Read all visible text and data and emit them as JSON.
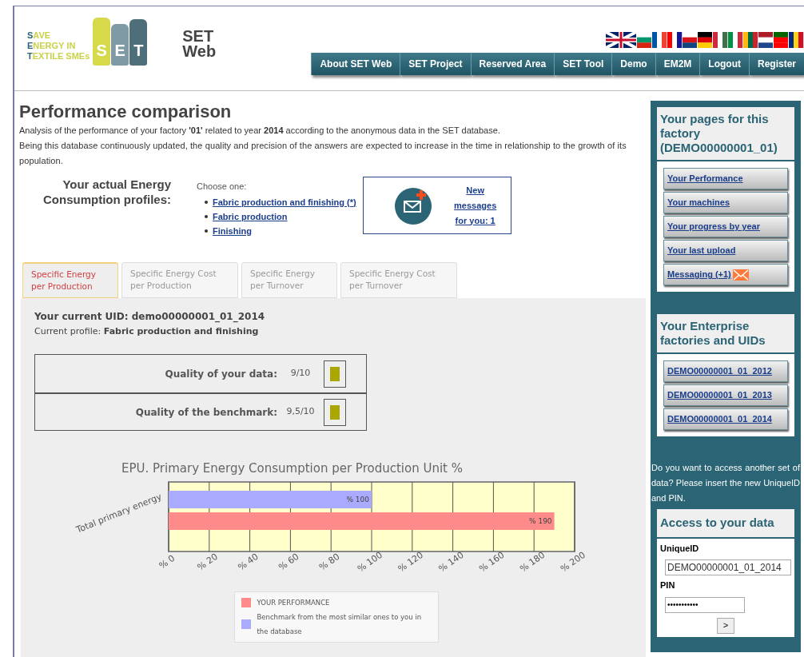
{
  "logo": {
    "lines": [
      "SAVE",
      "ENERGY IN",
      "TEXTILE SMEs"
    ],
    "spool_letters": [
      "S",
      "E",
      "T"
    ]
  },
  "site_title": [
    "SET",
    "Web"
  ],
  "nav": [
    "About SET Web",
    "SET Project",
    "Reserved Area",
    "SET Tool",
    "Demo",
    "EM2M",
    "Logout",
    "Register"
  ],
  "page": {
    "title": "Performance comparison",
    "intro": "Analysis of the performance of your factory **'01'** related to year **2014** according to the anonymous data in the SET database.",
    "note": "Being this database continuously updated, the quality and precision of the answers are expected to increase in the time in relationship to the growth of its population.",
    "profiles_label": "Your actual Energy Consumption profiles:",
    "choose": "Choose one:",
    "profiles": [
      "Fabric production and finishing (*)",
      "Fabric production",
      "Finishing"
    ],
    "messages_link": "New messages for you: 1"
  },
  "tabs": [
    {
      "label": "Specific Energy per Production",
      "selected": true
    },
    {
      "label": "Specific Energy Cost per Production",
      "selected": false
    },
    {
      "label": "Specific Energy per Turnover",
      "selected": false
    },
    {
      "label": "Specific Energy Cost per Turnover",
      "selected": false
    }
  ],
  "panel": {
    "uid": "Your current UID: demo00000001_01_2014",
    "profile_label": "Current profile:",
    "profile": "Fabric production and finishing",
    "quality": [
      {
        "label": "Quality of your data:",
        "value": "9/10",
        "color": "#aaa800"
      },
      {
        "label": "Quality of the benchmark:",
        "value": "9,5/10",
        "color": "#aaa800"
      }
    ],
    "chart_data": {
      "type": "bar",
      "orientation": "horizontal",
      "title": "EPU. Primary Energy Consumption per Production Unit %",
      "categories": [
        "Total primary energy"
      ],
      "series": [
        {
          "name": "Benchmark from the most similar ones to you in the database",
          "color": "#aaaaff",
          "values": [
            100
          ],
          "value_labels": [
            "% 100"
          ]
        },
        {
          "name": "YOUR PERFORMANCE",
          "color": "#ff8a8a",
          "values": [
            190
          ],
          "value_labels": [
            "% 190"
          ]
        }
      ],
      "legend": "bottom",
      "xlim": [
        0,
        200
      ],
      "xticks": [
        {
          "value": 0,
          "label": "% 0"
        },
        {
          "value": 20,
          "label": "% 20"
        },
        {
          "value": 40,
          "label": "% 40"
        },
        {
          "value": 60,
          "label": "% 60"
        },
        {
          "value": 80,
          "label": "% 80"
        },
        {
          "value": 100,
          "label": "% 100"
        },
        {
          "value": 120,
          "label": "% 120"
        },
        {
          "value": 140,
          "label": "% 140"
        },
        {
          "value": 160,
          "label": "% 160"
        },
        {
          "value": 180,
          "label": "% 180"
        },
        {
          "value": 200,
          "label": "% 200"
        }
      ],
      "grid": true
    }
  },
  "sidebar": {
    "pages_title": "Your pages for this factory (DEMO00000001_01)",
    "pages": [
      {
        "label": "Your Performance",
        "kind": "link"
      },
      {
        "label": "Your machines",
        "kind": "link"
      },
      {
        "label": "Your progress by year",
        "kind": "link"
      },
      {
        "label": "Your last upload",
        "kind": "link"
      },
      {
        "label": "Messaging (+1)",
        "kind": "mail"
      }
    ],
    "factories_title": "Your Enterprise factories and UIDs",
    "factories": [
      "DEMO00000001_01_2012",
      "DEMO00000001_01_2013",
      "DEMO00000001_01_2014"
    ],
    "access_prompt": "Do you want to access another set of data? Please insert the new UniqueID and PIN.",
    "access_title": "Access to your data",
    "uid_label": "UniqueID",
    "uid_value": "DEMO00000001_01_2014",
    "pin_label": "PIN",
    "pin_value": "•••••••••••",
    "submit": ">"
  }
}
